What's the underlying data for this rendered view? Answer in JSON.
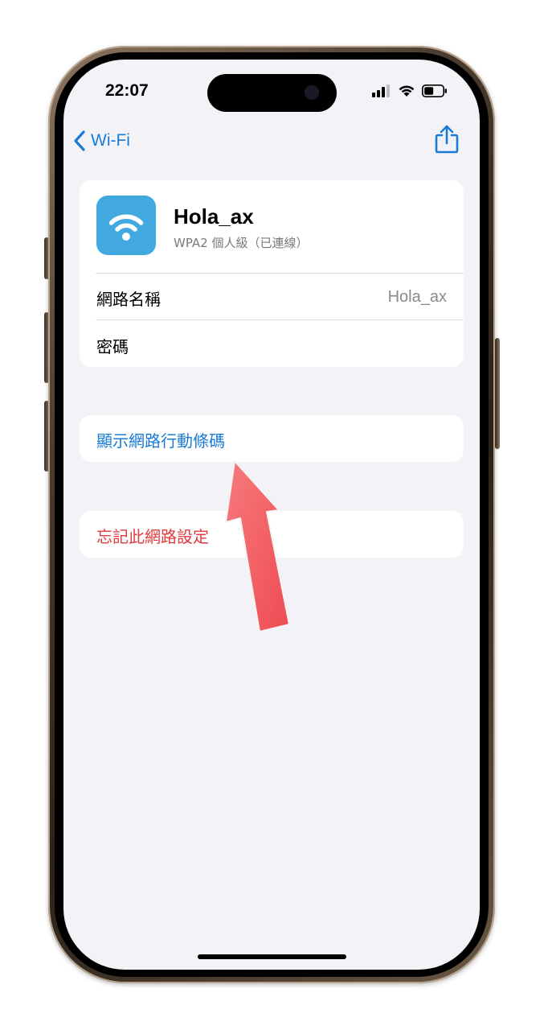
{
  "status_bar": {
    "time": "22:07",
    "signal_icon": "cellular-signal-icon",
    "wifi_icon": "wifi-icon",
    "battery_icon": "battery-icon"
  },
  "nav": {
    "back_label": "Wi-Fi",
    "back_icon": "chevron-left-icon",
    "share_icon": "share-icon"
  },
  "network": {
    "name": "Hola_ax",
    "subtitle": "WPA2 個人級（已連線）",
    "icon": "wifi-icon",
    "icon_color": "#42a9e0"
  },
  "rows": {
    "name_label": "網路名稱",
    "name_value": "Hola_ax",
    "password_label": "密碼"
  },
  "actions": {
    "show_qr_label": "顯示網路行動條碼",
    "forget_label": "忘記此網路設定"
  },
  "colors": {
    "accent": "#1a7bd6",
    "destructive": "#e0393e",
    "annotation_arrow": "#f15b5f",
    "background": "#f2f2f7"
  }
}
